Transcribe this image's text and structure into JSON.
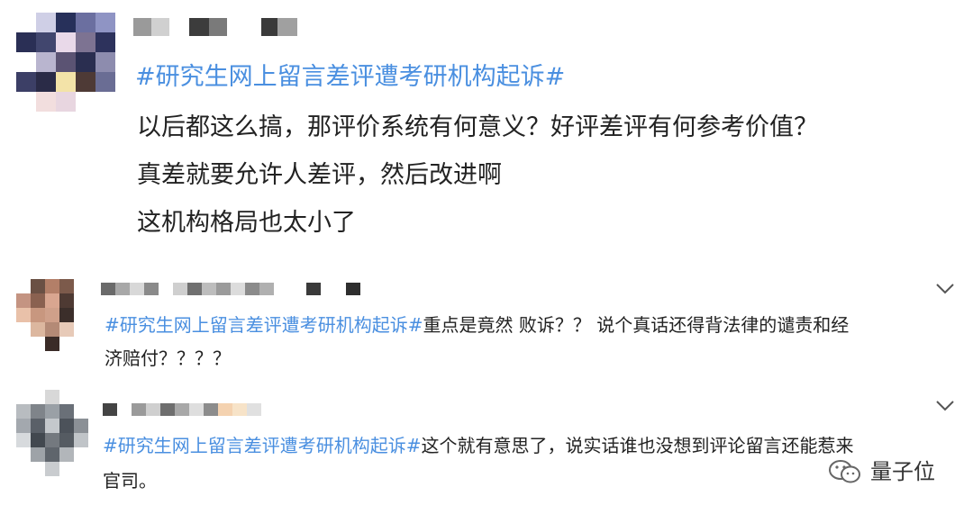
{
  "post": {
    "hashtag": "#研究生网上留言差评遭考研机构起诉#",
    "lines": [
      "以后都这么搞，那评价系统有何意义？好评差评有何参考价值？",
      "真差就要允许人差评，然后改进啊",
      "这机构格局也太小了"
    ]
  },
  "comments": [
    {
      "hashtag": "#研究生网上留言差评遭考研机构起诉#",
      "text1": "重点是竟然 败诉？？ 说个真话还得背法律的谴责和经",
      "text2": "济赔付？？？？"
    },
    {
      "hashtag": "#研究生网上留言差评遭考研机构起诉#",
      "text1": "这个就有意思了，说实话谁也没想到评论留言还能惹来",
      "text2": "官司。"
    }
  ],
  "watermark": {
    "label": "量子位",
    "icon": "wechat-icon"
  },
  "colors": {
    "hashtag": "#4a8fe0",
    "text": "#222222",
    "chevron": "#555555"
  }
}
